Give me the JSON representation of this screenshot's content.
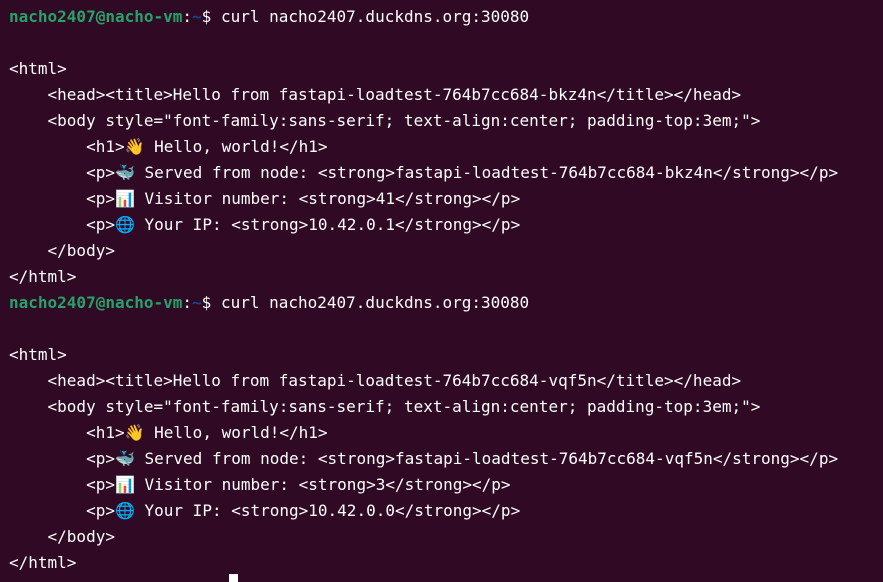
{
  "prompt": {
    "user_host": "nacho2407@nacho-vm",
    "separator": ":",
    "path": "~",
    "symbol": "$ "
  },
  "lines": [
    {
      "type": "prompt",
      "command": "curl nacho2407.duckdns.org:30080"
    },
    {
      "type": "text",
      "text": ""
    },
    {
      "type": "text",
      "text": "<html>"
    },
    {
      "type": "text",
      "text": "    <head><title>Hello from fastapi-loadtest-764b7cc684-bkz4n</title></head>"
    },
    {
      "type": "text",
      "text": "    <body style=\"font-family:sans-serif; text-align:center; padding-top:3em;\">"
    },
    {
      "type": "text",
      "text": "        <h1>👋 Hello, world!</h1>"
    },
    {
      "type": "text",
      "text": "        <p>🐳 Served from node: <strong>fastapi-loadtest-764b7cc684-bkz4n</strong></p>"
    },
    {
      "type": "text",
      "text": "        <p>📊 Visitor number: <strong>41</strong></p>"
    },
    {
      "type": "text",
      "text": "        <p>🌐 Your IP: <strong>10.42.0.1</strong></p>"
    },
    {
      "type": "text",
      "text": "    </body>"
    },
    {
      "type": "text",
      "text": "</html>"
    },
    {
      "type": "prompt",
      "command": "curl nacho2407.duckdns.org:30080"
    },
    {
      "type": "text",
      "text": ""
    },
    {
      "type": "text",
      "text": "<html>"
    },
    {
      "type": "text",
      "text": "    <head><title>Hello from fastapi-loadtest-764b7cc684-vqf5n</title></head>"
    },
    {
      "type": "text",
      "text": "    <body style=\"font-family:sans-serif; text-align:center; padding-top:3em;\">"
    },
    {
      "type": "text",
      "text": "        <h1>👋 Hello, world!</h1>"
    },
    {
      "type": "text",
      "text": "        <p>🐳 Served from node: <strong>fastapi-loadtest-764b7cc684-vqf5n</strong></p>"
    },
    {
      "type": "text",
      "text": "        <p>📊 Visitor number: <strong>3</strong></p>"
    },
    {
      "type": "text",
      "text": "        <p>🌐 Your IP: <strong>10.42.0.0</strong></p>"
    },
    {
      "type": "text",
      "text": "    </body>"
    },
    {
      "type": "text",
      "text": "</html>"
    }
  ],
  "colors": {
    "background": "#300a24",
    "foreground": "#ffffff",
    "user_host": "#26a269",
    "path": "#12488b"
  }
}
